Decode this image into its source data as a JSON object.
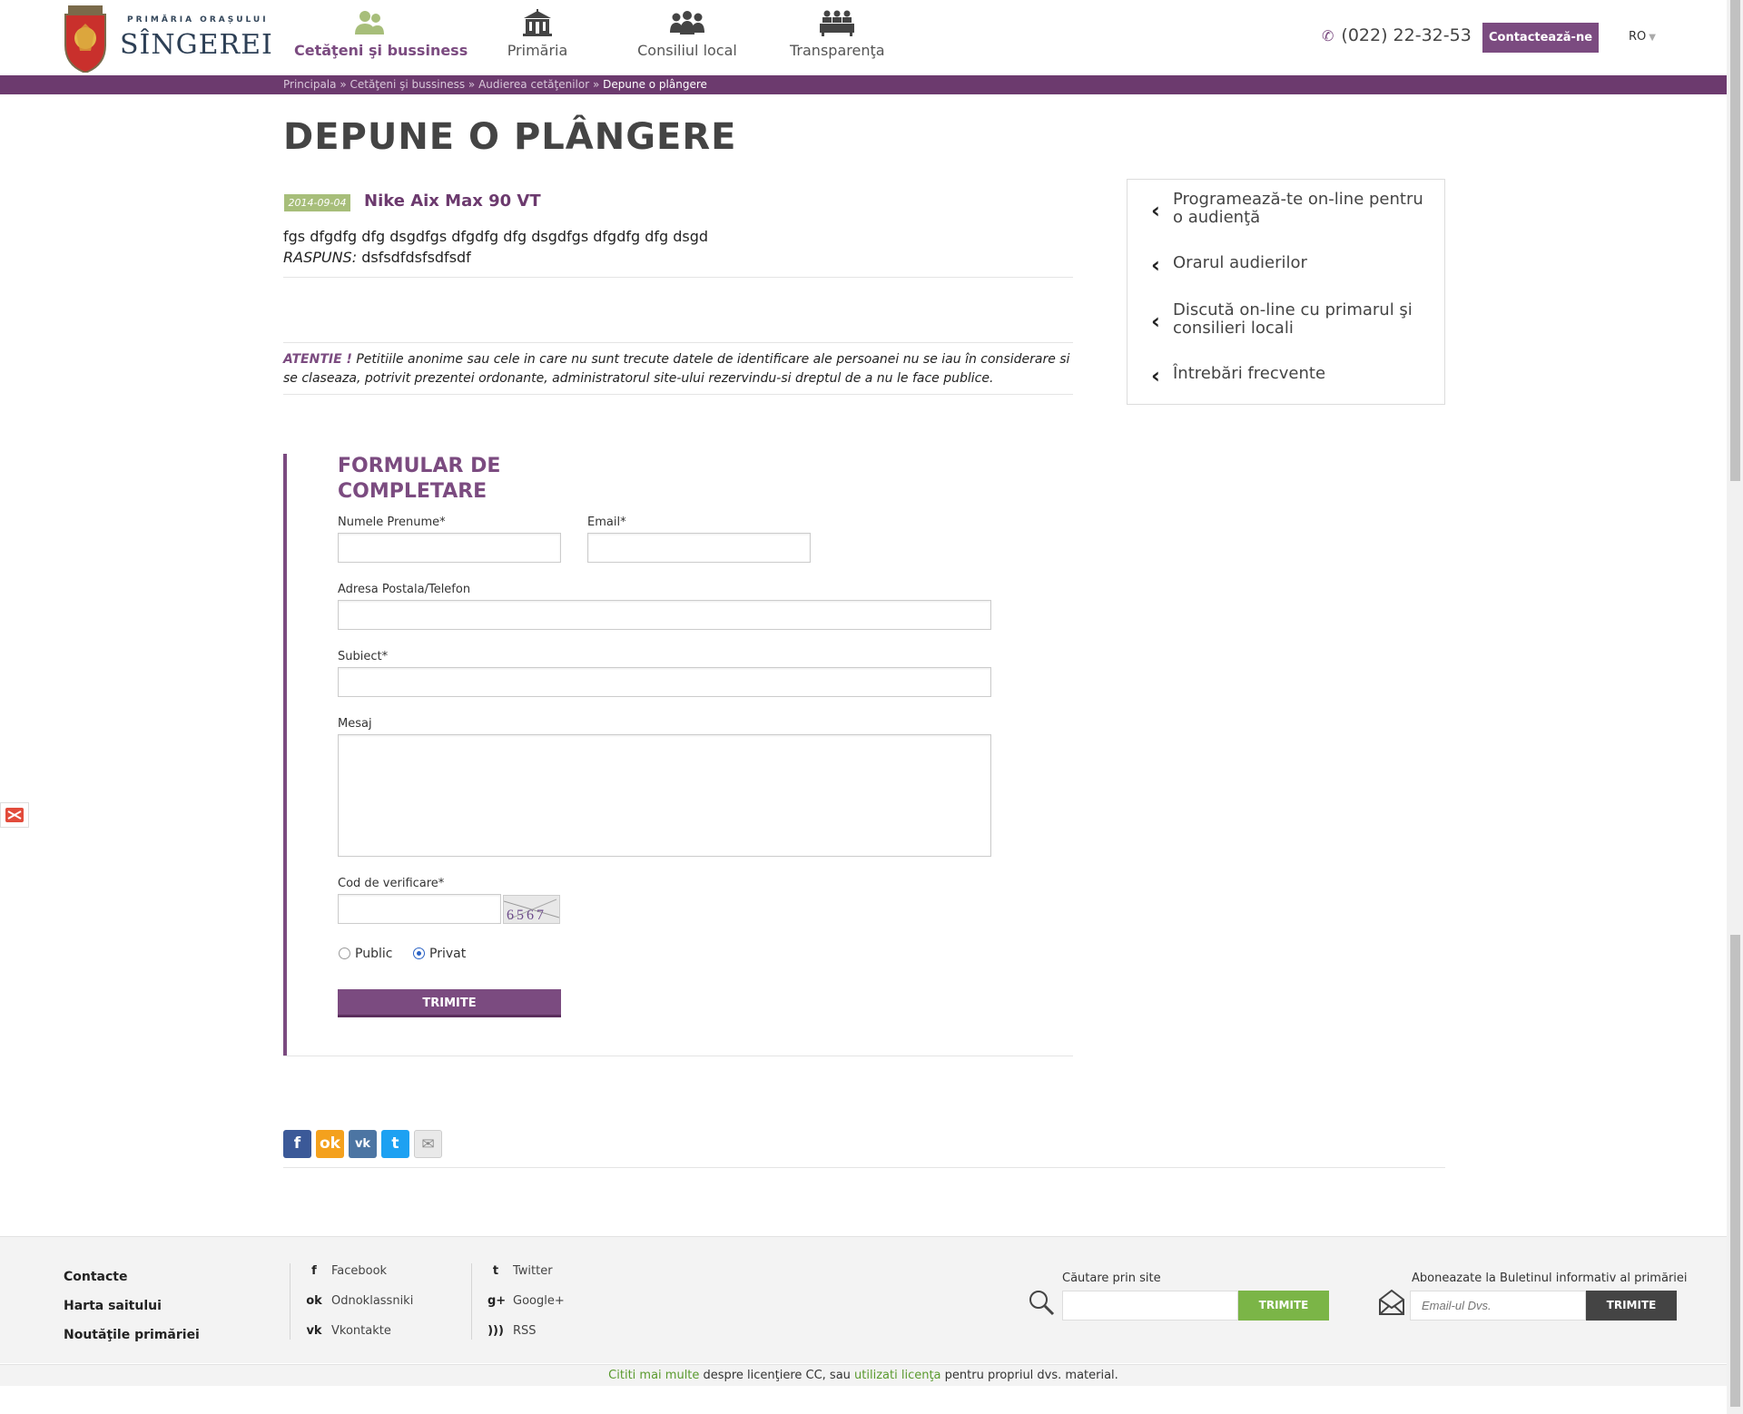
{
  "header": {
    "logo_sub": "PRIMĂRIA ORAȘULUI",
    "logo_name": "SÎNGEREI",
    "nav": [
      {
        "label": "Cetăţeni şi bussiness",
        "icon": "citizens-icon"
      },
      {
        "label": "Primăria",
        "icon": "city-hall-icon"
      },
      {
        "label": "Consiliul local",
        "icon": "council-icon"
      },
      {
        "label": "Transparenţa",
        "icon": "transparency-icon"
      }
    ],
    "phone": "(022) 22-32-53",
    "contact_button": "Contactează-ne",
    "language": "RO"
  },
  "breadcrumb": {
    "items": [
      "Principala",
      "Cetăţeni şi bussiness",
      "Audierea cetăţenilor"
    ],
    "separator": " » ",
    "current": "Depune o plângere"
  },
  "page": {
    "title": "DEPUNE O PLÂNGERE",
    "entry": {
      "date": "2014-09-04",
      "title": "Nike Aix Max 90 VT",
      "text": "fgs dfgdfg dfg dsgdfgs dfgdfg dfg dsgdfgs dfgdfg dfg dsgd",
      "answer_label": "RASPUNS:",
      "answer": "dsfsdfdsfsdfsdf"
    },
    "warning_label": "ATENTIE !",
    "warning_text": "Petitiile anonime sau cele in care nu sunt trecute datele de identificare ale persoanei nu se iau în considerare si se claseaza, potrivit prezentei ordonante, administratorul site-ului rezervindu-si dreptul de a nu le face publice."
  },
  "sidebar": {
    "items": [
      "Programează-te on-line pentru o audienţă",
      "Orarul audierilor",
      "Discută on-line cu primarul şi consilieri locali",
      "Întrebări frecvente"
    ]
  },
  "form": {
    "title_line1": "FORMULAR DE",
    "title_line2": "COMPLETARE",
    "name_label": "Numele Prenume*",
    "email_label": "Email*",
    "address_label": "Adresa Postala/Telefon",
    "subject_label": "Subiect*",
    "message_label": "Mesaj",
    "captcha_label": "Cod de verificare*",
    "captcha_text": "6567",
    "radio_public": "Public",
    "radio_private": "Privat",
    "selected_visibility": "Privat",
    "submit": "TRIMITE"
  },
  "share": {
    "buttons": [
      "facebook",
      "odnoklassniki",
      "vkontakte",
      "twitter",
      "email"
    ],
    "colors": {
      "facebook": "#3b5998",
      "odnoklassniki": "#f4a11d",
      "vkontakte": "#4c75a3",
      "twitter": "#1da1f2",
      "email": "#e9e9e9"
    }
  },
  "footer": {
    "links": [
      "Contacte",
      "Harta saitului",
      "Noutăţile primăriei"
    ],
    "social_col1": [
      "Facebook",
      "Odnoklassniki",
      "Vkontakte"
    ],
    "social_col2": [
      "Twitter",
      "Google+",
      "RSS"
    ],
    "search_label": "Căutare prin site",
    "search_button": "TRIMITE",
    "newsletter_label": "Aboneazate la Buletinul informativ al primăriei",
    "newsletter_placeholder": "Email-ul Dvs.",
    "newsletter_button": "TRIMITE"
  },
  "license": {
    "link1": "Cititi mai multe",
    "text1": " despre licenţiere CC, sau ",
    "link2": "utilizati licenţa",
    "text2": " pentru propriul dvs. material."
  },
  "colors": {
    "brand": "#7b4b80",
    "breadbar": "#6c3a6e",
    "green": "#7bb547",
    "date_badge": "#a7be7a"
  }
}
